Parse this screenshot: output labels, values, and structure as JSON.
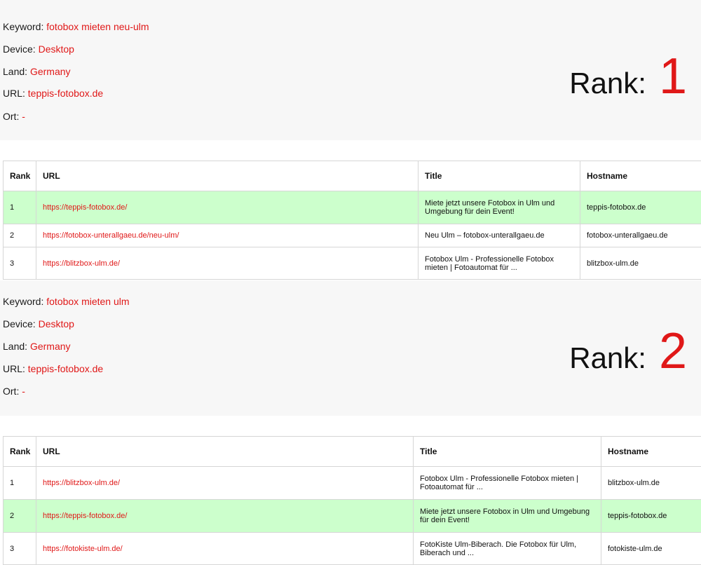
{
  "blocks": [
    {
      "meta": {
        "keyword_label": "Keyword:",
        "keyword": "fotobox mieten neu-ulm",
        "device_label": "Device:",
        "device": "Desktop",
        "land_label": "Land:",
        "land": "Germany",
        "url_label": "URL:",
        "url": "teppis-fotobox.de",
        "ort_label": "Ort:",
        "ort": "-"
      },
      "rank_label": "Rank:",
      "rank": "1",
      "table": {
        "headers": [
          "Rank",
          "URL",
          "Title",
          "Hostname"
        ],
        "rows": [
          {
            "rank": "1",
            "url": "https://teppis-fotobox.de/",
            "title": "Miete jetzt unsere Fotobox in Ulm und Umgebung für dein Event!",
            "hostname": "teppis-fotobox.de",
            "highlight": true
          },
          {
            "rank": "2",
            "url": "https://fotobox-unterallgaeu.de/neu-ulm/",
            "title": "Neu Ulm – fotobox-unterallgaeu.de",
            "hostname": "fotobox-unterallgaeu.de",
            "highlight": false
          },
          {
            "rank": "3",
            "url": "https://blitzbox-ulm.de/",
            "title": "Fotobox Ulm - Professionelle Fotobox mieten | Fotoautomat für ...",
            "hostname": "blitzbox-ulm.de",
            "highlight": false
          }
        ]
      }
    },
    {
      "meta": {
        "keyword_label": "Keyword:",
        "keyword": "fotobox mieten ulm",
        "device_label": "Device:",
        "device": "Desktop",
        "land_label": "Land:",
        "land": "Germany",
        "url_label": "URL:",
        "url": "teppis-fotobox.de",
        "ort_label": "Ort:",
        "ort": "-"
      },
      "rank_label": "Rank:",
      "rank": "2",
      "table": {
        "headers": [
          "Rank",
          "URL",
          "Title",
          "Hostname"
        ],
        "rows": [
          {
            "rank": "1",
            "url": "https://blitzbox-ulm.de/",
            "title": "Fotobox Ulm - Professionelle Fotobox mieten | Fotoautomat für ...",
            "hostname": "blitzbox-ulm.de",
            "highlight": false
          },
          {
            "rank": "2",
            "url": "https://teppis-fotobox.de/",
            "title": "Miete jetzt unsere Fotobox in Ulm und Umgebung für dein Event!",
            "hostname": "teppis-fotobox.de",
            "highlight": true
          },
          {
            "rank": "3",
            "url": "https://fotokiste-ulm.de/",
            "title": "FotoKiste Ulm-Biberach. Die Fotobox für Ulm, Biberach und ...",
            "hostname": "fotokiste-ulm.de",
            "highlight": false
          }
        ]
      }
    }
  ],
  "colors": {
    "accent": "#e01818",
    "highlight_row": "#ccffcc",
    "panel_bg": "#f7f7f7"
  }
}
